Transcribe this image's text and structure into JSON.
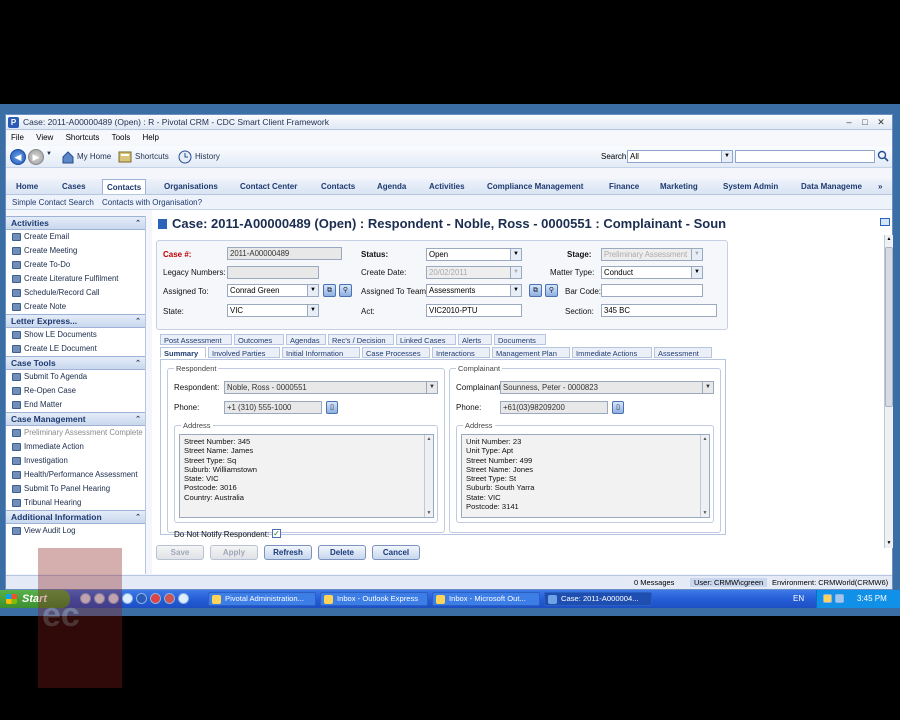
{
  "window": {
    "title": "Case: 2011-A00000489 (Open)  : R - Pivotal CRM - CDC Smart Client Framework"
  },
  "menu": [
    "File",
    "View",
    "Shortcuts",
    "Tools",
    "Help"
  ],
  "nav": {
    "my_home": "My Home",
    "shortcuts": "Shortcuts",
    "history": "History",
    "search_label": "Search",
    "search_scope": "All",
    "search_value": ""
  },
  "main_tabs": [
    "Home",
    "Cases",
    "Contacts",
    "Organisations",
    "Contact Center",
    "Contacts",
    "Agenda",
    "Activities",
    "Compliance Management",
    "Finance",
    "Marketing",
    "System Admin",
    "Data Manageme"
  ],
  "sub_links": [
    "Simple Contact Search",
    "Contacts with Organisation?"
  ],
  "sidebar": {
    "sections": [
      {
        "title": "Activities",
        "items": [
          "Create Email",
          "Create Meeting",
          "Create To-Do",
          "Create Literature Fulfilment",
          "Schedule/Record Call",
          "Create Note"
        ]
      },
      {
        "title": "Letter Express...",
        "items": [
          "Show LE Documents",
          "Create LE Document"
        ]
      },
      {
        "title": "Case Tools",
        "items": [
          "Submit To Agenda",
          "Re-Open Case",
          "End Matter"
        ]
      },
      {
        "title": "Case Management",
        "items": [
          "Preliminary Assessment Complete",
          "Immediate Action",
          "Investigation",
          "Health/Performance Assessment",
          "Submit To Panel Hearing",
          "Tribunal Hearing"
        ]
      },
      {
        "title": "Additional Information",
        "items": [
          "View Audit Log"
        ]
      }
    ]
  },
  "case": {
    "header": "Case: 2011-A00000489 (Open)  : Respondent - Noble, Ross - 0000551 : Complainant - Soun",
    "labels": {
      "case_no": "Case #:",
      "legacy": "Legacy Numbers:",
      "assigned_to": "Assigned To:",
      "state": "State:",
      "status": "Status:",
      "create_date": "Create Date:",
      "assigned_team": "Assigned To Team:",
      "act": "Act:",
      "stage": "Stage:",
      "matter_type": "Matter Type:",
      "bar_code": "Bar Code:",
      "section": "Section:"
    },
    "values": {
      "case_no": "2011-A00000489",
      "legacy": "",
      "assigned_to": "Conrad Green",
      "state": "VIC",
      "status": "Open",
      "create_date": "20/02/2011",
      "assigned_team": "Assessments",
      "act": "VIC2010-PTU",
      "stage": "Preliminary Assessment",
      "matter_type": "Conduct",
      "bar_code": "",
      "section": "345 BC"
    }
  },
  "subtabs_row1": [
    "Post Assessment",
    "Outcomes",
    "Agendas",
    "Rec's / Decision",
    "Linked Cases",
    "Alerts",
    "Documents"
  ],
  "subtabs_row2": [
    "Summary",
    "Involved Parties",
    "Initial Information",
    "Case Processes",
    "Interactions",
    "Management Plan",
    "Immediate Actions",
    "Assessment"
  ],
  "respondent": {
    "group": "Respondent",
    "label": "Respondent:",
    "value": "Noble, Ross - 0000551",
    "phone_label": "Phone:",
    "phone": "+1 (310) 555-1000",
    "address_group": "Address",
    "address": "Street Number: 345\nStreet Name: James\nStreet Type: Sq\nSuburb: Williamstown\nState: VIC\nPostcode: 3016\nCountry: Australia",
    "notify_label": "Do Not Notify Respondent:"
  },
  "complainant": {
    "group": "Complainant",
    "label": "Complainant:",
    "value": "Sounness, Peter - 0000823",
    "phone_label": "Phone:",
    "phone": "+61(03)98209200",
    "address_group": "Address",
    "address": "Unit Number: 23\nUnit Type: Apt\nStreet Number: 499\nStreet Name: Jones\nStreet Type: St\nSuburb: South Yarra\nState: VIC\nPostcode: 3141"
  },
  "buttons": {
    "save": "Save",
    "apply": "Apply",
    "refresh": "Refresh",
    "delete": "Delete",
    "cancel": "Cancel"
  },
  "status": {
    "messages": "0 Messages",
    "user": "User: CRMW\\cgreen",
    "environment": "Environment: CRMWorld(CRMW6)"
  },
  "taskbar": {
    "start": "Start",
    "items": [
      "Pivotal Administration...",
      "Inbox - Outlook Express",
      "Inbox - Microsoft Out...",
      "Case: 2011-A000004..."
    ],
    "lang": "EN",
    "clock": "3:45 PM"
  }
}
